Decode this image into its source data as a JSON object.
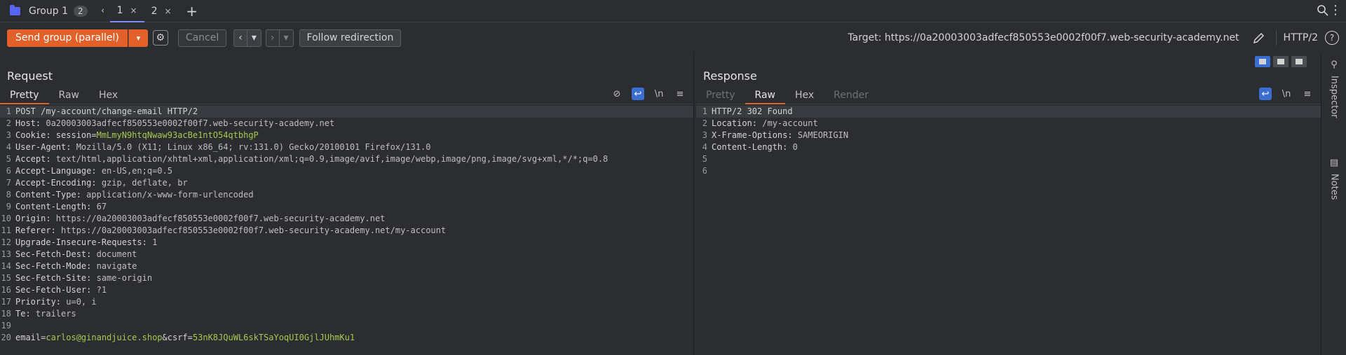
{
  "tabbar": {
    "group_label": "Group 1",
    "group_count": "2",
    "tabs": [
      {
        "label": "1",
        "active": true
      },
      {
        "label": "2",
        "active": false
      }
    ]
  },
  "toolbar": {
    "send_label": "Send group (parallel)",
    "cancel_label": "Cancel",
    "follow_label": "Follow redirection",
    "target_label": "Target: https://0a20003003adfecf850553e0002f00f7.web-security-academy.net",
    "http_version": "HTTP/2"
  },
  "request": {
    "title": "Request",
    "tabs": [
      "Pretty",
      "Raw",
      "Hex"
    ],
    "active_tab": "Pretty",
    "lines": [
      {
        "n": "1",
        "key": "POST /my-account/change-email HTTP/2",
        "val": ""
      },
      {
        "n": "2",
        "key": "Host: ",
        "val": "0a20003003adfecf850553e0002f00f7.web-security-academy.net"
      },
      {
        "n": "3",
        "key": "Cookie: session=",
        "val": "MmLmyN9htqNwaw93acBe1ntO54qtbhgP",
        "green": true
      },
      {
        "n": "4",
        "key": "User-Agent: ",
        "val": "Mozilla/5.0 (X11; Linux x86_64; rv:131.0) Gecko/20100101 Firefox/131.0"
      },
      {
        "n": "5",
        "key": "Accept: ",
        "val": "text/html,application/xhtml+xml,application/xml;q=0.9,image/avif,image/webp,image/png,image/svg+xml,*/*;q=0.8"
      },
      {
        "n": "6",
        "key": "Accept-Language: ",
        "val": "en-US,en;q=0.5"
      },
      {
        "n": "7",
        "key": "Accept-Encoding: ",
        "val": "gzip, deflate, br"
      },
      {
        "n": "8",
        "key": "Content-Type: ",
        "val": "application/x-www-form-urlencoded"
      },
      {
        "n": "9",
        "key": "Content-Length: ",
        "val": "67"
      },
      {
        "n": "10",
        "key": "Origin: ",
        "val": "https://0a20003003adfecf850553e0002f00f7.web-security-academy.net"
      },
      {
        "n": "11",
        "key": "Referer: ",
        "val": "https://0a20003003adfecf850553e0002f00f7.web-security-academy.net/my-account"
      },
      {
        "n": "12",
        "key": "Upgrade-Insecure-Requests: ",
        "val": "1"
      },
      {
        "n": "13",
        "key": "Sec-Fetch-Dest: ",
        "val": "document"
      },
      {
        "n": "14",
        "key": "Sec-Fetch-Mode: ",
        "val": "navigate"
      },
      {
        "n": "15",
        "key": "Sec-Fetch-Site: ",
        "val": "same-origin"
      },
      {
        "n": "16",
        "key": "Sec-Fetch-User: ",
        "val": "?1"
      },
      {
        "n": "17",
        "key": "Priority: ",
        "val": "u=0, i"
      },
      {
        "n": "18",
        "key": "Te: ",
        "val": "trailers"
      },
      {
        "n": "19",
        "key": "",
        "val": ""
      },
      {
        "n": "20",
        "key": "",
        "val": ""
      }
    ],
    "body_line": {
      "p1": "email=",
      "v1": "carlos@ginandjuice.shop",
      "p2": "&csrf=",
      "v2": "53nK8JQuWL6skTSaYoqUI0GjlJUhmKu1"
    }
  },
  "response": {
    "title": "Response",
    "tabs": [
      "Pretty",
      "Raw",
      "Hex",
      "Render"
    ],
    "active_tab": "Raw",
    "lines": [
      {
        "n": "1",
        "text": "HTTP/2 302 Found"
      },
      {
        "n": "2",
        "key": "Location: ",
        "val": "/my-account"
      },
      {
        "n": "3",
        "key": "X-Frame-Options: ",
        "val": "SAMEORIGIN"
      },
      {
        "n": "4",
        "key": "Content-Length: ",
        "val": "0"
      },
      {
        "n": "5",
        "text": ""
      },
      {
        "n": "6",
        "text": ""
      }
    ]
  },
  "sidebar": {
    "inspector_label": "Inspector",
    "notes_label": "Notes"
  },
  "colors": {
    "accent": "#e2612a",
    "blue": "#3a6fd1",
    "value_green": "#a6c94f"
  }
}
